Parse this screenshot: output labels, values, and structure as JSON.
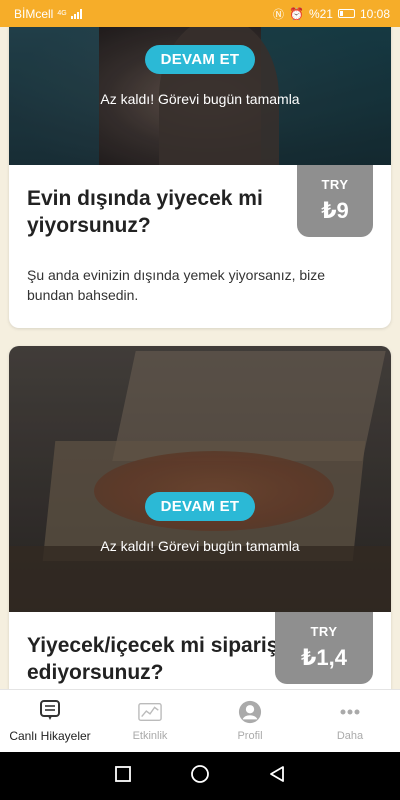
{
  "status_bar": {
    "carrier": "BİMcell",
    "network_type": "4G",
    "battery_level": "%21",
    "time": "10:08"
  },
  "feed": {
    "cards": [
      {
        "cta_label": "DEVAM ET",
        "cta_note": "Az kaldı! Görevi bugün tamamla",
        "title": "Evin dışında yiyecek mi yiyorsunuz?",
        "description": "Şu anda evinizin dışında yemek yiyorsanız, bize bundan bahsedin.",
        "price_currency": "TRY",
        "price_amount": "₺9"
      },
      {
        "cta_label": "DEVAM ET",
        "cta_note": "Az kaldı! Görevi bugün tamamla",
        "title": "Yiyecek/içecek mi sipariş ediyorsunuz?",
        "description": "",
        "price_currency": "TRY",
        "price_amount": "₺1,4"
      }
    ]
  },
  "bottom_nav": {
    "items": [
      {
        "label": "Canlı Hikayeler",
        "icon": "chat-bubble-icon",
        "active": true
      },
      {
        "label": "Etkinlik",
        "icon": "activity-chart-icon",
        "active": false
      },
      {
        "label": "Profil",
        "icon": "profile-icon",
        "active": false
      },
      {
        "label": "Daha",
        "icon": "more-dots-icon",
        "active": false
      }
    ]
  },
  "colors": {
    "status_bar": "#f6ad29",
    "cta": "#2bb9d6",
    "price_tag": "#8f8f8f",
    "background": "#f5efdf"
  }
}
